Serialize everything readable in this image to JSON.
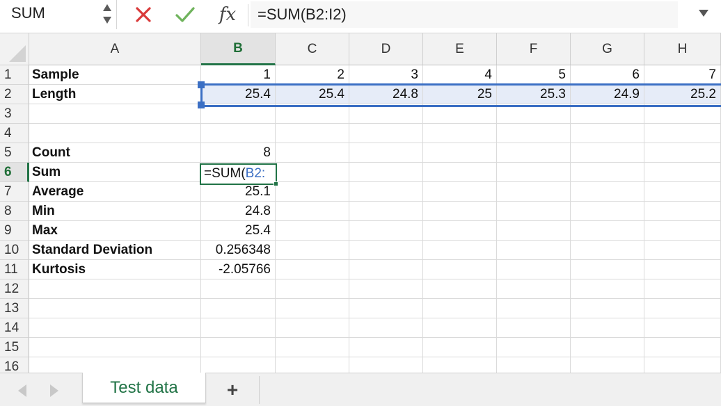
{
  "formula_bar": {
    "name_box": "SUM",
    "formula": "=SUM(B2:I2)",
    "fx_label": "fx"
  },
  "icons": {
    "cancel": "x-icon",
    "enter": "check-icon",
    "spinner": "spinner-arrows-icon",
    "expand": "chevron-down-icon",
    "nav_prev": "triangle-left-icon",
    "nav_next": "triangle-right-icon",
    "add": "plus-icon"
  },
  "colors": {
    "accent_green": "#217346",
    "reference_blue": "#3b6fc4",
    "cancel_red": "#d93a3a",
    "enter_green": "#6fb35c",
    "range_fill": "#e6ecf8"
  },
  "grid": {
    "selected_column": "B",
    "selected_row": "6",
    "columns": [
      "A",
      "B",
      "C",
      "D",
      "E",
      "F",
      "G",
      "H"
    ],
    "rows": [
      "1",
      "2",
      "3",
      "4",
      "5",
      "6",
      "7",
      "8",
      "9",
      "10",
      "11",
      "12",
      "13",
      "14",
      "15",
      "16"
    ],
    "row1": {
      "A": "Sample",
      "B": "1",
      "C": "2",
      "D": "3",
      "E": "4",
      "F": "5",
      "G": "6",
      "H": "7"
    },
    "row2": {
      "A": "Length",
      "B": "25.4",
      "C": "25.4",
      "D": "24.8",
      "E": "25",
      "F": "25.3",
      "G": "24.9",
      "H": "25.2"
    },
    "stats": [
      {
        "row": "5",
        "label": "Count",
        "value": "8"
      },
      {
        "row": "6",
        "label": "Sum",
        "value": ""
      },
      {
        "row": "7",
        "label": "Average",
        "value": "25.1"
      },
      {
        "row": "8",
        "label": "Min",
        "value": "24.8"
      },
      {
        "row": "9",
        "label": "Max",
        "value": "25.4"
      },
      {
        "row": "10",
        "label": "Standard Deviation",
        "value": "0.256348"
      },
      {
        "row": "11",
        "label": "Kurtosis",
        "value": "-2.05766"
      }
    ],
    "active_cell": {
      "address": "B6",
      "prefix": "=SUM(",
      "reference": "B2:"
    }
  },
  "sheets": {
    "tabs": [
      "Test data"
    ],
    "active": "Test data",
    "add_label": "+"
  }
}
